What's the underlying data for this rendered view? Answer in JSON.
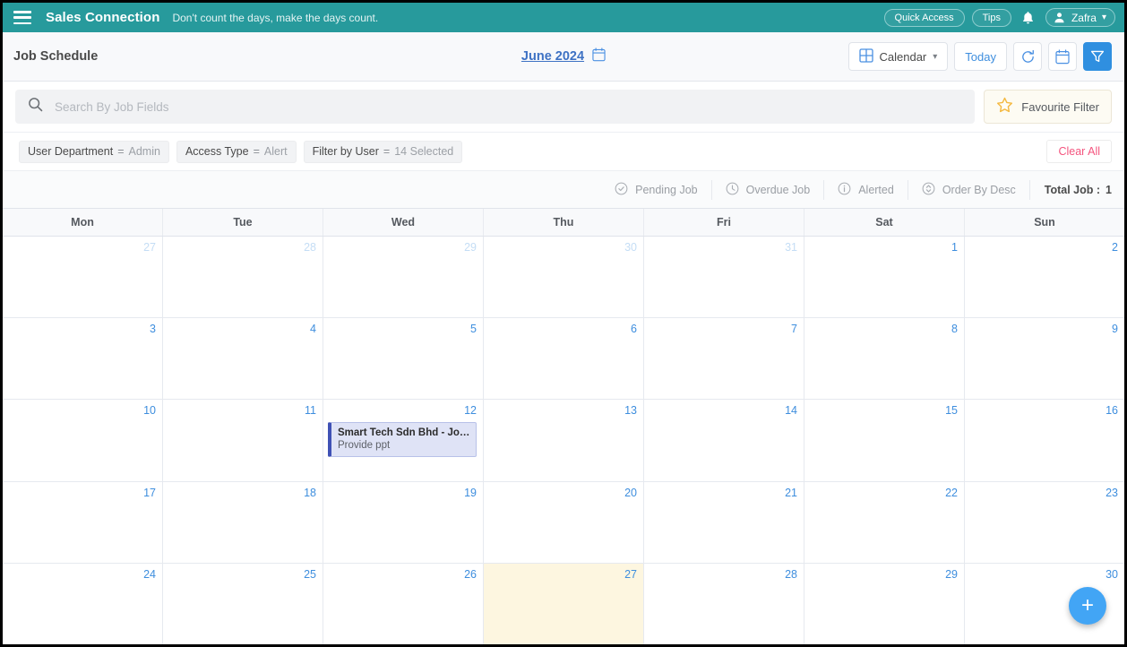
{
  "topbar": {
    "menu_icon": "hamburger-icon",
    "brand": "Sales Connection",
    "tagline": "Don't count the days, make the days count.",
    "quick_access": "Quick Access",
    "tips": "Tips",
    "bell_icon": "bell-icon",
    "user_name": "Zafra",
    "accent_color": "#279a9c"
  },
  "toolbar": {
    "page_title": "Job Schedule",
    "month_label": "June 2024",
    "month_icon": "calendar-icon",
    "view_label": "Calendar",
    "view_icon": "grid-icon",
    "today_label": "Today",
    "refresh_icon": "refresh-icon",
    "date_picker_icon": "calendar-icon",
    "filter_icon": "funnel-icon",
    "primary_color": "#2f8fe0"
  },
  "search": {
    "icon": "search-icon",
    "value": "",
    "placeholder": "Search By Job Fields",
    "favourite_filter_label": "Favourite Filter",
    "star_icon": "star-icon"
  },
  "filters": {
    "chips": [
      {
        "key": "User Department",
        "eq": "=",
        "value": "Admin"
      },
      {
        "key": "Access Type",
        "eq": "=",
        "value": "Alert"
      },
      {
        "key": "Filter by User",
        "eq": "=",
        "value": "14 Selected"
      }
    ],
    "clear_all": "Clear All",
    "clear_all_color": "#f4547e"
  },
  "legend": {
    "items": [
      {
        "label": "Pending Job",
        "icon": "check-circle-icon"
      },
      {
        "label": "Overdue Job",
        "icon": "clock-circle-icon"
      },
      {
        "label": "Alerted",
        "icon": "info-circle-icon"
      },
      {
        "label": "Order By Desc",
        "icon": "sort-circle-icon"
      }
    ],
    "total_job_label": "Total Job :",
    "total_job_value": "1"
  },
  "calendar": {
    "weekdays": [
      "Mon",
      "Tue",
      "Wed",
      "Thu",
      "Fri",
      "Sat",
      "Sun"
    ],
    "weeks": [
      [
        {
          "day": "27",
          "out": true
        },
        {
          "day": "28",
          "out": true
        },
        {
          "day": "29",
          "out": true
        },
        {
          "day": "30",
          "out": true
        },
        {
          "day": "31",
          "out": true
        },
        {
          "day": "1",
          "out": false
        },
        {
          "day": "2",
          "out": false
        }
      ],
      [
        {
          "day": "3",
          "out": false
        },
        {
          "day": "4",
          "out": false
        },
        {
          "day": "5",
          "out": false
        },
        {
          "day": "6",
          "out": false
        },
        {
          "day": "7",
          "out": false
        },
        {
          "day": "8",
          "out": false
        },
        {
          "day": "9",
          "out": false
        }
      ],
      [
        {
          "day": "10",
          "out": false
        },
        {
          "day": "11",
          "out": false
        },
        {
          "day": "12",
          "out": false,
          "events": [
            {
              "title": "Smart Tech Sdn Bhd - Johan",
              "subtitle": "Provide ppt",
              "bar_color": "#3f51b5",
              "bg_color": "#dfe3f6"
            }
          ]
        },
        {
          "day": "13",
          "out": false
        },
        {
          "day": "14",
          "out": false
        },
        {
          "day": "15",
          "out": false
        },
        {
          "day": "16",
          "out": false
        }
      ],
      [
        {
          "day": "17",
          "out": false
        },
        {
          "day": "18",
          "out": false
        },
        {
          "day": "19",
          "out": false
        },
        {
          "day": "20",
          "out": false
        },
        {
          "day": "21",
          "out": false
        },
        {
          "day": "22",
          "out": false
        },
        {
          "day": "23",
          "out": false
        }
      ],
      [
        {
          "day": "24",
          "out": false
        },
        {
          "day": "25",
          "out": false
        },
        {
          "day": "26",
          "out": false
        },
        {
          "day": "27",
          "out": false,
          "today": true
        },
        {
          "day": "28",
          "out": false
        },
        {
          "day": "29",
          "out": false
        },
        {
          "day": "30",
          "out": false
        }
      ]
    ],
    "today_highlight_color": "#fdf6e0"
  },
  "fab": {
    "label": "+",
    "icon": "plus-icon",
    "color": "#42a5f5"
  }
}
